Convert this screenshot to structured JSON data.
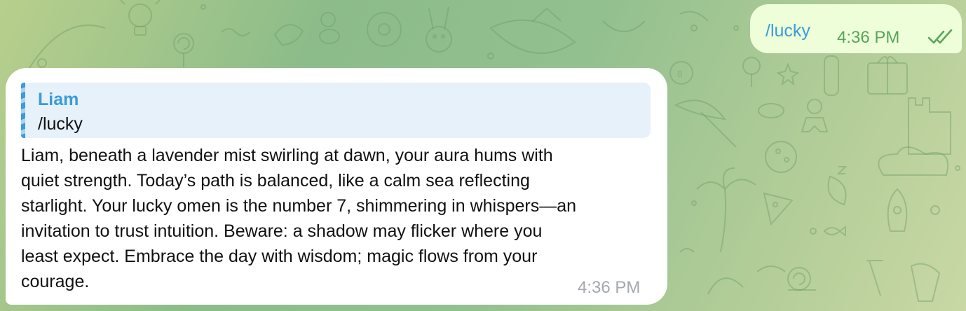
{
  "outgoing": {
    "text": "/lucky",
    "time": "4:36 PM",
    "status_icon": "double-check-icon",
    "color_text": "#3a9bd8",
    "color_time": "#58a55c"
  },
  "incoming": {
    "reply_to": {
      "name": "Liam",
      "text": "/lucky"
    },
    "lines": [
      "Liam, beneath a lavender mist swirling at dawn, your aura hums with",
      "quiet strength. Today’s path is balanced, like a calm sea reflecting",
      "starlight. Your lucky omen is the number 7, shimmering in whispers—an",
      "invitation to trust intuition. Beware: a shadow may flicker where you",
      "least expect. Embrace the day with wisdom; magic flows from your",
      "courage."
    ],
    "time": "4:36 PM"
  },
  "background": {
    "pattern_icons": [
      "lightbulb-icon",
      "rabbit-icon",
      "donut-icon",
      "umbrella-icon",
      "palm-tree-icon",
      "pizza-icon",
      "rocket-icon",
      "gingerbread-icon",
      "moon-icon",
      "gift-icon",
      "star-icon",
      "lollipop-icon",
      "billiard-ball-icon",
      "snail-icon",
      "fish-icon"
    ]
  }
}
